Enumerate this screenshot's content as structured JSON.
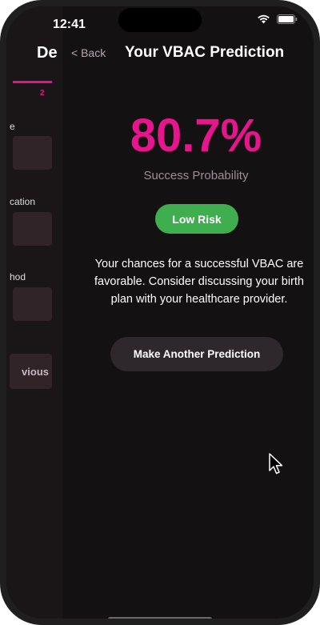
{
  "status_bar": {
    "time": "12:41"
  },
  "back_screen": {
    "title": "De",
    "step_number": "2",
    "labels": [
      "e",
      "cation",
      "hod"
    ],
    "previous_label": "vious"
  },
  "nav": {
    "back_label": "< Back",
    "title": "Your VBAC Prediction"
  },
  "result": {
    "percentage": "80.7%",
    "subtitle": "Success Probability",
    "risk_label": "Low Risk",
    "message": "Your chances for a successful VBAC are favorable. Consider discussing your birth plan with your healthcare provider.",
    "again_label": "Make Another Prediction"
  },
  "colors": {
    "accent": "#e6158c",
    "low_risk": "#3fae4f",
    "background": "#141113"
  }
}
